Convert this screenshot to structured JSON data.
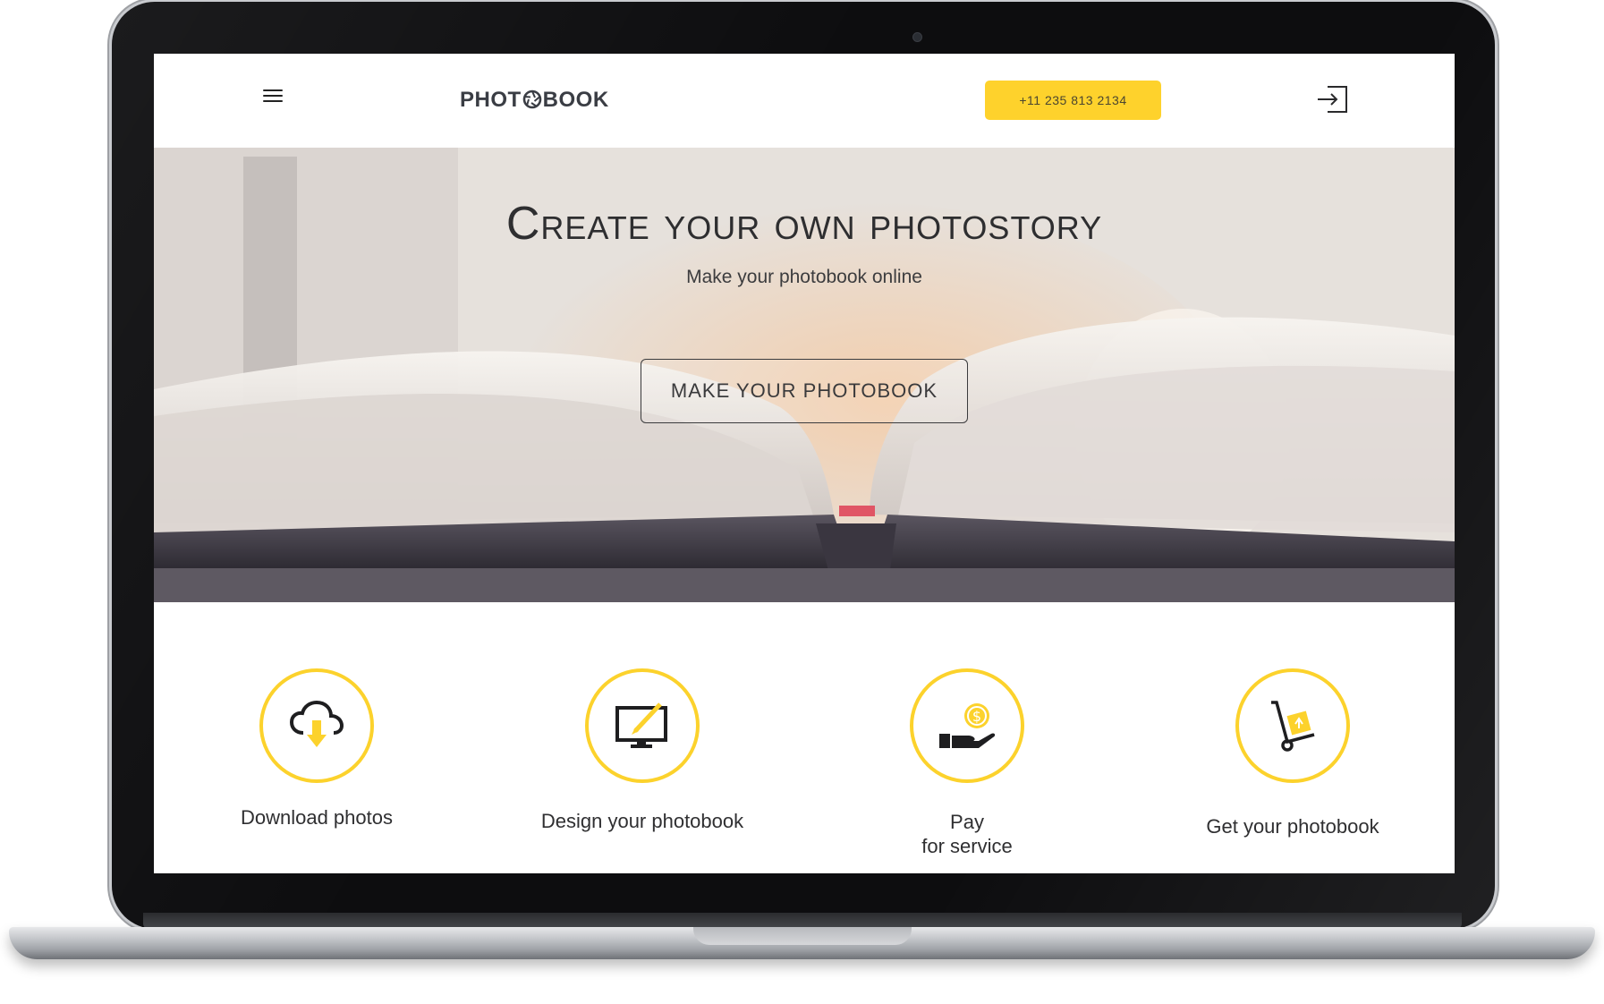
{
  "header": {
    "logo": "PHOTOBOOK",
    "phone": "+11 235 813 2134",
    "menu_icon": "hamburger-menu-icon",
    "login_icon": "sign-in-icon"
  },
  "hero": {
    "title": "Create your own photostory",
    "subtitle": "Make your photobook online",
    "cta_label": "MAKE YOUR PHOTOBOOK"
  },
  "steps": [
    {
      "label": "Download photos",
      "icon": "cloud-download-icon"
    },
    {
      "label": "Design your photobook",
      "icon": "monitor-pencil-icon"
    },
    {
      "label_line1": "Pay",
      "label_line2": "for service",
      "icon": "hand-coin-icon"
    },
    {
      "label": "Get your photobook",
      "icon": "hand-truck-icon"
    }
  ],
  "colors": {
    "accent": "#fed22c",
    "text": "#2f2f31",
    "bezel": "#0d0d0f"
  }
}
